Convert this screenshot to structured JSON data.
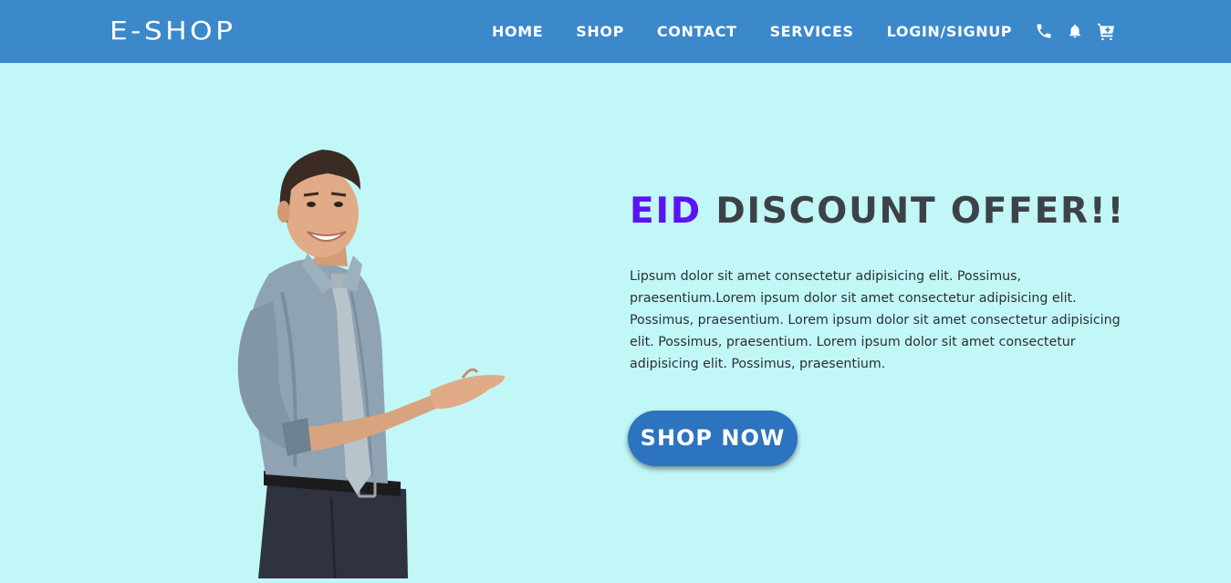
{
  "header": {
    "brand": "E-SHOP",
    "nav": [
      {
        "label": "HOME"
      },
      {
        "label": "SHOP"
      },
      {
        "label": "CONTACT"
      },
      {
        "label": "SERVICES"
      },
      {
        "label": "LOGIN/SIGNUP"
      }
    ],
    "icons": [
      "phone-icon",
      "bell-icon",
      "cart-icon"
    ]
  },
  "hero": {
    "headline_accent": "EID",
    "headline_rest": " DISCOUNT OFFER!!",
    "description": "Lipsum dolor sit amet consectetur adipisicing elit. Possimus, praesentium.Lorem ipsum dolor sit amet consectetur adipisicing elit. Possimus, praesentium. Lorem ipsum dolor sit amet consectetur adipisicing elit. Possimus, praesentium. Lorem ipsum dolor sit amet consectetur adipisicing elit. Possimus, praesentium.",
    "cta_label": "SHOP NOW"
  },
  "colors": {
    "header_bg": "#3b88cb",
    "page_bg": "#c2f7f7",
    "accent": "#5a14f2",
    "headline": "#3d4246",
    "button_bg": "#2c73c0"
  }
}
